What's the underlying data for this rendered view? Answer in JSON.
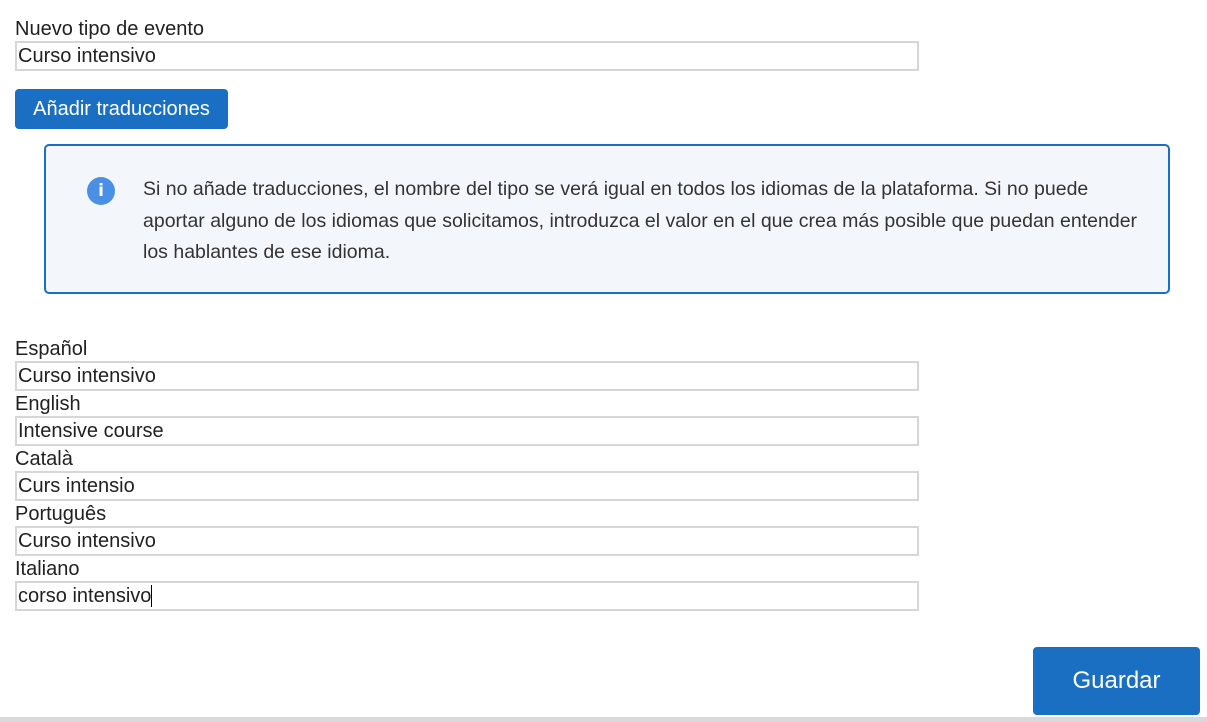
{
  "event_type": {
    "label": "Nuevo tipo de evento",
    "value": "Curso intensivo"
  },
  "add_translations_label": "Añadir traducciones",
  "info": {
    "icon": "info-icon",
    "text": "Si no añade traducciones, el nombre del tipo se verá igual en todos los idiomas de la plataforma. Si no puede aportar alguno de los idiomas que solicitamos, introduzca el valor en el que crea más posible que puedan entender los hablantes de ese idioma.",
    "accent_color": "#1a6fc2"
  },
  "translations": [
    {
      "label": "Español",
      "value": "Curso intensivo"
    },
    {
      "label": "English",
      "value": "Intensive course"
    },
    {
      "label": "Català",
      "value": "Curs intensio"
    },
    {
      "label": "Português",
      "value": "Curso intensivo"
    },
    {
      "label": "Italiano",
      "value": "corso intensivo"
    }
  ],
  "save_label": "Guardar"
}
